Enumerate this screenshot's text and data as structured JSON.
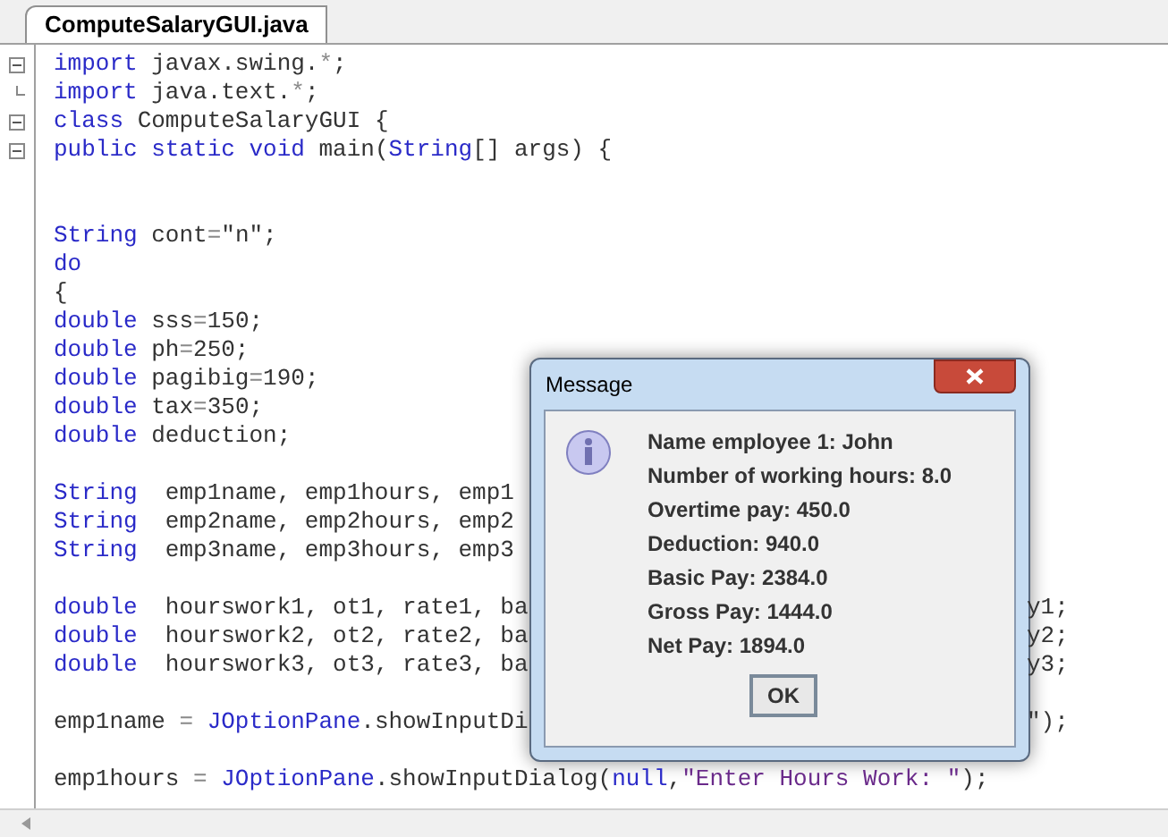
{
  "editor": {
    "tab": {
      "label": "ComputeSalaryGUI.java",
      "selected": true
    },
    "lines": [
      {
        "kind": "code",
        "collapsible": true,
        "tokens": [
          {
            "text": "import",
            "kind": "kw"
          },
          {
            "text": " javax.swing.",
            "kind": "id"
          },
          {
            "text": "*",
            "kind": "op"
          },
          {
            "text": ";",
            "kind": "id"
          }
        ]
      },
      {
        "kind": "code",
        "fold_end": true,
        "tokens": [
          {
            "text": "import",
            "kind": "kw"
          },
          {
            "text": " java.text.",
            "kind": "id"
          },
          {
            "text": "*",
            "kind": "op"
          },
          {
            "text": ";",
            "kind": "id"
          }
        ]
      },
      {
        "kind": "code",
        "collapsible": true,
        "tokens": [
          {
            "text": "class",
            "kind": "kw"
          },
          {
            "text": " ComputeSalaryGUI {",
            "kind": "id"
          }
        ]
      },
      {
        "kind": "code",
        "collapsible": true,
        "tokens": [
          {
            "text": "public static void",
            "kind": "kw"
          },
          {
            "text": " main(",
            "kind": "id"
          },
          {
            "text": "String",
            "kind": "kw"
          },
          {
            "text": "[] args) {",
            "kind": "id"
          }
        ]
      },
      {
        "kind": "blank"
      },
      {
        "kind": "blank"
      },
      {
        "kind": "code",
        "tokens": [
          {
            "text": "String",
            "kind": "kw"
          },
          {
            "text": " cont",
            "kind": "id"
          },
          {
            "text": "=",
            "kind": "op"
          },
          {
            "text": "\"n\";",
            "kind": "id"
          }
        ]
      },
      {
        "kind": "code",
        "tokens": [
          {
            "text": "do",
            "kind": "kw"
          }
        ]
      },
      {
        "kind": "code",
        "tokens": [
          {
            "text": "{",
            "kind": "id"
          }
        ]
      },
      {
        "kind": "code",
        "tokens": [
          {
            "text": "double",
            "kind": "kw"
          },
          {
            "text": " sss",
            "kind": "id"
          },
          {
            "text": "=",
            "kind": "op"
          },
          {
            "text": "150;",
            "kind": "id"
          }
        ]
      },
      {
        "kind": "code",
        "tokens": [
          {
            "text": "double",
            "kind": "kw"
          },
          {
            "text": " ph",
            "kind": "id"
          },
          {
            "text": "=",
            "kind": "op"
          },
          {
            "text": "250;",
            "kind": "id"
          }
        ]
      },
      {
        "kind": "code",
        "tokens": [
          {
            "text": "double",
            "kind": "kw"
          },
          {
            "text": " pagibig",
            "kind": "id"
          },
          {
            "text": "=",
            "kind": "op"
          },
          {
            "text": "190;",
            "kind": "id"
          }
        ]
      },
      {
        "kind": "code",
        "tokens": [
          {
            "text": "double",
            "kind": "kw"
          },
          {
            "text": " tax",
            "kind": "id"
          },
          {
            "text": "=",
            "kind": "op"
          },
          {
            "text": "350;",
            "kind": "id"
          }
        ]
      },
      {
        "kind": "code",
        "tokens": [
          {
            "text": "double",
            "kind": "kw"
          },
          {
            "text": " deduction;",
            "kind": "id"
          }
        ]
      },
      {
        "kind": "blank"
      },
      {
        "kind": "code",
        "tokens": [
          {
            "text": "String",
            "kind": "kw"
          },
          {
            "text": "  emp1name, emp1hours, emp1",
            "kind": "id"
          }
        ]
      },
      {
        "kind": "code",
        "tokens": [
          {
            "text": "String",
            "kind": "kw"
          },
          {
            "text": "  emp2name, emp2hours, emp2",
            "kind": "id"
          }
        ]
      },
      {
        "kind": "code",
        "tokens": [
          {
            "text": "String",
            "kind": "kw"
          },
          {
            "text": "  emp3name, emp3hours, emp3",
            "kind": "id"
          }
        ]
      },
      {
        "kind": "blank"
      },
      {
        "kind": "code",
        "tokens": [
          {
            "text": "double",
            "kind": "kw"
          },
          {
            "text": "  hourswork1, ot1, rate1, ba",
            "kind": "id"
          }
        ],
        "right": "y1;"
      },
      {
        "kind": "code",
        "tokens": [
          {
            "text": "double",
            "kind": "kw"
          },
          {
            "text": "  hourswork2, ot2, rate2, ba",
            "kind": "id"
          }
        ],
        "right": "y2;"
      },
      {
        "kind": "code",
        "tokens": [
          {
            "text": "double",
            "kind": "kw"
          },
          {
            "text": "  hourswork3, ot3, rate3, ba",
            "kind": "id"
          }
        ],
        "right": "y3;"
      },
      {
        "kind": "blank"
      },
      {
        "kind": "code",
        "tokens": [
          {
            "text": "emp1name",
            "kind": "id"
          },
          {
            "text": " = ",
            "kind": "op"
          },
          {
            "text": "JOptionPane",
            "kind": "kw"
          },
          {
            "text": ".showInputDi",
            "kind": "id"
          }
        ],
        "right": "\");"
      },
      {
        "kind": "blank"
      },
      {
        "kind": "code",
        "tokens": [
          {
            "text": "emp1hours",
            "kind": "id"
          },
          {
            "text": " = ",
            "kind": "op"
          },
          {
            "text": "JOptionPane",
            "kind": "kw"
          },
          {
            "text": ".showInputDialog(",
            "kind": "id"
          },
          {
            "text": "null",
            "kind": "kw"
          },
          {
            "text": ",",
            "kind": "id"
          },
          {
            "text": "\"Enter Hours Work: \"",
            "kind": "str"
          },
          {
            "text": ");",
            "kind": "id"
          }
        ]
      }
    ]
  },
  "dialog": {
    "title": "Message",
    "lines": [
      "Name employee 1: John",
      "Number of working hours: 8.0",
      "Overtime pay: 450.0",
      "Deduction: 940.0",
      "Basic Pay: 2384.0",
      "Gross Pay: 1444.0",
      "Net Pay: 1894.0"
    ],
    "button": "OK"
  }
}
